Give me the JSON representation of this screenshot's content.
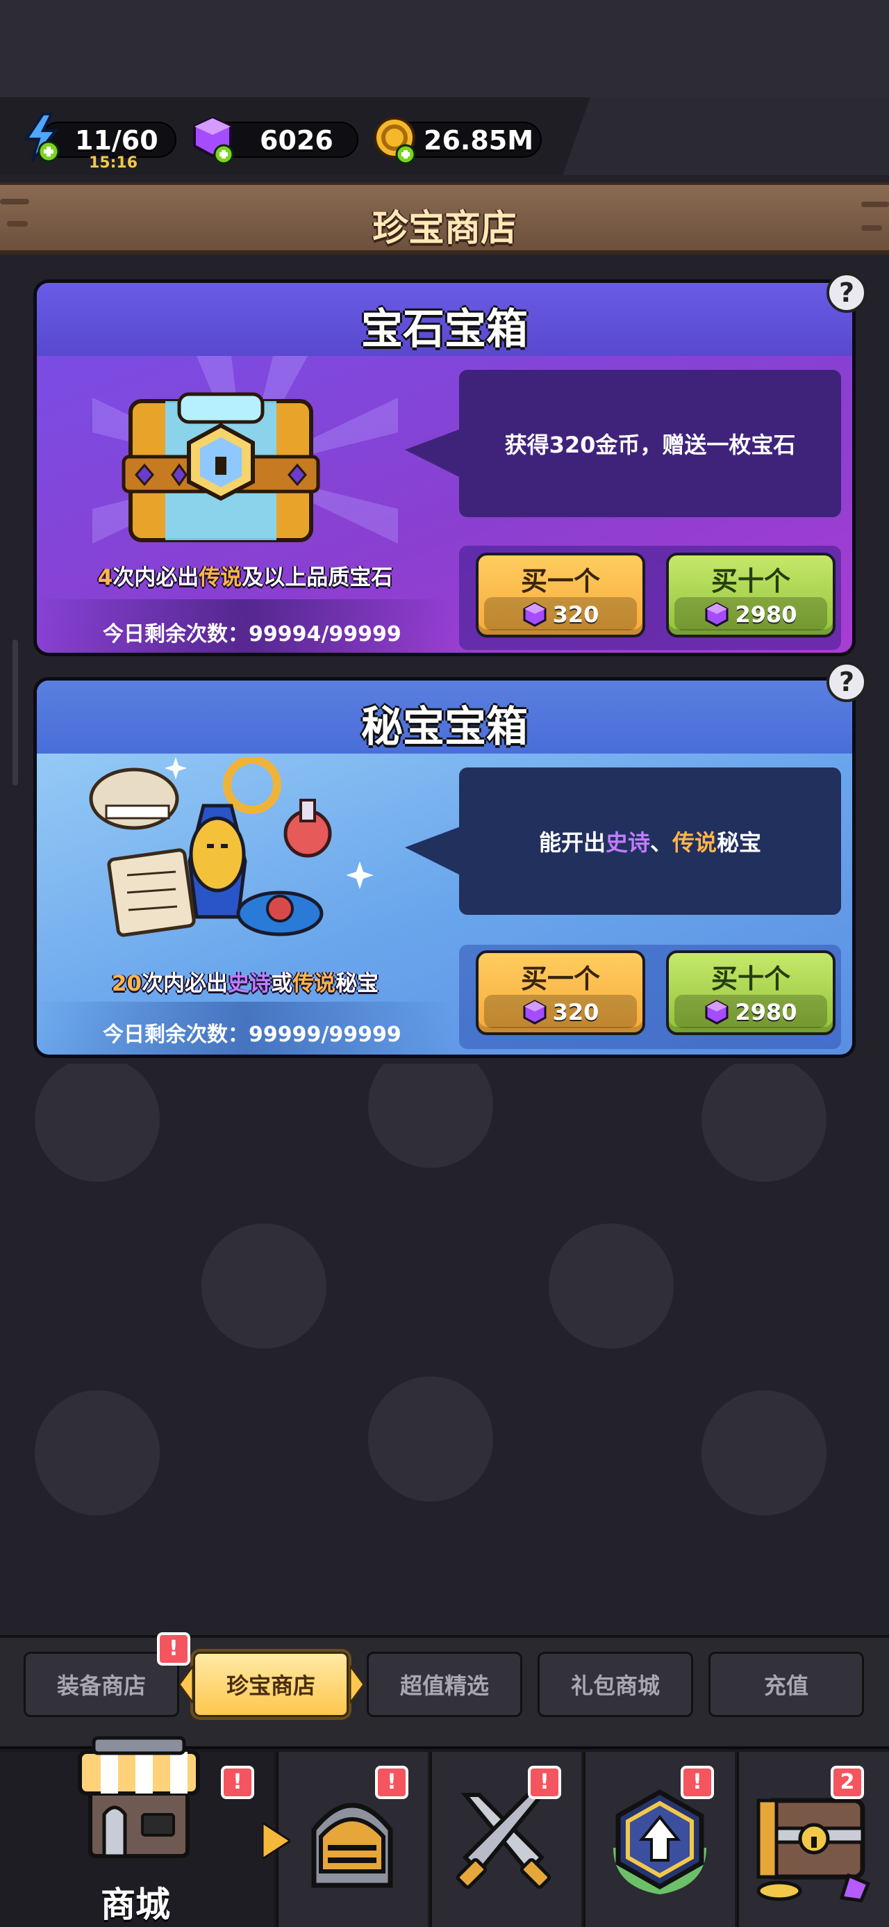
{
  "resources": {
    "energy": {
      "value": "11/60",
      "timer": "15:16",
      "icon": "lightning-plus-icon"
    },
    "gems": {
      "value": "6026",
      "icon": "purple-gem-plus-icon"
    },
    "gold": {
      "value": "26.85M",
      "icon": "gold-coin-plus-icon"
    }
  },
  "page_title": "珍宝商店",
  "cards": [
    {
      "title": "宝石宝箱",
      "description": "获得320金币，赠送一枚宝石",
      "guarantee": {
        "count": "4",
        "t1": "次内必出",
        "h1": "传说",
        "t2": "及以上品质宝石"
      },
      "remaining": "今日剩余次数：99994/99999",
      "buy_one": {
        "label": "买一个",
        "price": "320"
      },
      "buy_ten": {
        "label": "买十个",
        "price": "2980"
      }
    },
    {
      "title": "秘宝宝箱",
      "description": {
        "t1": "能开出",
        "h1": "史诗",
        "sep": "、",
        "h2": "传说",
        "t2": "秘宝"
      },
      "guarantee": {
        "count": "20",
        "t1": "次内必出",
        "h1": "史诗",
        "or": "或",
        "h2": "传说",
        "t2": "秘宝"
      },
      "remaining": "今日剩余次数：99999/99999",
      "buy_one": {
        "label": "买一个",
        "price": "320"
      },
      "buy_ten": {
        "label": "买十个",
        "price": "2980"
      }
    }
  ],
  "help": "?",
  "shop_tabs": [
    "装备商店",
    "珍宝商店",
    "超值精选",
    "礼包商城",
    "充值"
  ],
  "shop_tab_badge": "!",
  "bottom_nav": {
    "label": "商城",
    "badges": [
      "!",
      "!",
      "!",
      "!",
      "2"
    ],
    "icons": [
      "shop-stall-icon",
      "knight-helmet-icon",
      "crossed-swords-icon",
      "upgrade-arrow-icon",
      "treasure-chest-icon"
    ]
  },
  "colors": {
    "card1_header": "#5c4fd6",
    "card1_body": "#8a3fd0",
    "card2_header": "#4a6ed8",
    "card2_body": "#6aa6ec",
    "desc_box_1": "#3f237a",
    "desc_box_2": "#22305e"
  }
}
